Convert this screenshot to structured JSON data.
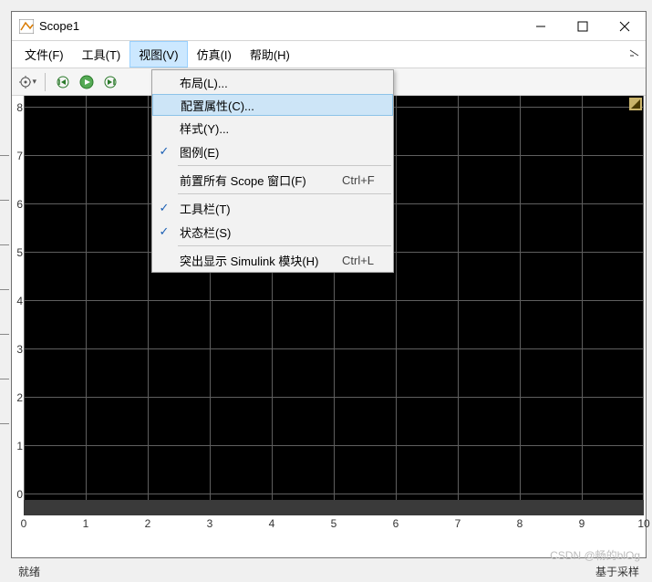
{
  "window": {
    "title": "Scope1"
  },
  "menubar": {
    "items": [
      "文件(F)",
      "工具(T)",
      "视图(V)",
      "仿真(I)",
      "帮助(H)"
    ],
    "active_index": 2
  },
  "dropdown": {
    "items": [
      {
        "label": "布局(L)...",
        "checked": false,
        "shortcut": ""
      },
      {
        "label": "配置属性(C)...",
        "checked": false,
        "shortcut": "",
        "highlighted": true
      },
      {
        "label": "样式(Y)...",
        "checked": false,
        "shortcut": ""
      },
      {
        "label": "图例(E)",
        "checked": true,
        "shortcut": ""
      },
      {
        "sep": true
      },
      {
        "label": "前置所有 Scope 窗口(F)",
        "checked": false,
        "shortcut": "Ctrl+F"
      },
      {
        "sep": true
      },
      {
        "label": "工具栏(T)",
        "checked": true,
        "shortcut": ""
      },
      {
        "label": "状态栏(S)",
        "checked": true,
        "shortcut": ""
      },
      {
        "sep": true
      },
      {
        "label": "突出显示 Simulink 模块(H)",
        "checked": false,
        "shortcut": "Ctrl+L"
      }
    ]
  },
  "status": {
    "left": "就绪",
    "right": "基于采样"
  },
  "watermark": "CSDN @畅的blOg",
  "chart_data": {
    "type": "line",
    "title": "",
    "xlabel": "",
    "ylabel": "",
    "xlim": [
      0,
      10
    ],
    "ylim": [
      0,
      8
    ],
    "xticks": [
      0,
      1,
      2,
      3,
      4,
      5,
      6,
      7,
      8,
      9,
      10
    ],
    "yticks": [
      0,
      1,
      2,
      3,
      4,
      5,
      6,
      7,
      8
    ],
    "grid": true,
    "series": []
  }
}
